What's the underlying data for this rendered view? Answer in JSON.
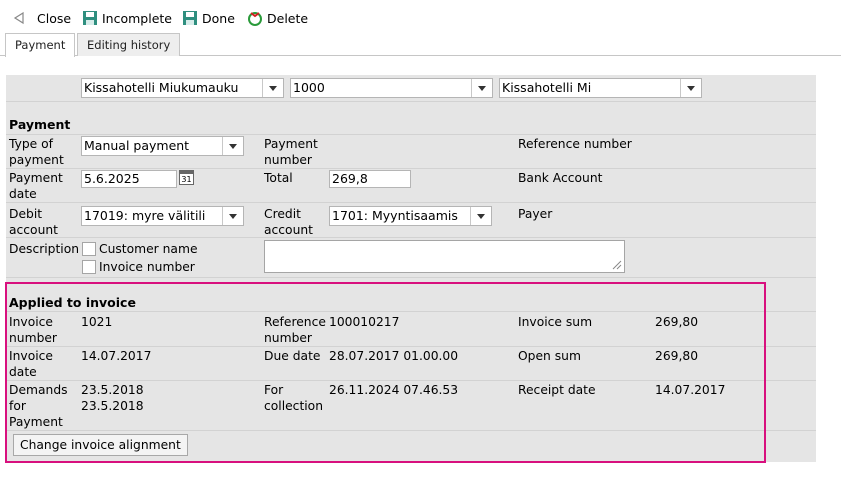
{
  "toolbar": {
    "close": "Close",
    "incomplete": "Incomplete",
    "done": "Done",
    "delete": "Delete"
  },
  "tabs": [
    "Payment",
    "Editing history"
  ],
  "top_selects": {
    "company": "Kissahotelli Miukumauku",
    "code": "1000",
    "short_name": "Kissahotelli Mi"
  },
  "payment": {
    "heading": "Payment",
    "type_label": "Type of payment",
    "type_value": "Manual payment",
    "number_label": "Payment number",
    "reference_label": "Reference number",
    "date_label": "Payment date",
    "date_value": "5.6.2025",
    "calendar_day": "31",
    "total_label": "Total",
    "total_value": "269,8",
    "bank_account_label": "Bank Account",
    "debit_label": "Debit account",
    "debit_value": "17019: myre välitili",
    "credit_label": "Credit account",
    "credit_value": "1701: Myyntisaamis",
    "payer_label": "Payer",
    "description_label": "Description",
    "customer_name_label": "Customer name",
    "invoice_number_label": "Invoice number"
  },
  "applied": {
    "heading": "Applied to invoice",
    "invoice_number_label": "Invoice number",
    "invoice_number": "1021",
    "reference_label": "Reference number",
    "reference": "100010217",
    "invoice_sum_label": "Invoice sum",
    "invoice_sum": "269,80",
    "invoice_date_label": "Invoice date",
    "invoice_date": "14.07.2017",
    "due_date_label": "Due date",
    "due_date": "28.07.2017 01.00.00",
    "open_sum_label": "Open sum",
    "open_sum": "269,80",
    "demands_label": "Demands for Payment",
    "demands_1": "23.5.2018",
    "demands_2": "23.5.2018",
    "collection_label": "For collection",
    "collection": "26.11.2024 07.46.53",
    "receipt_date_label": "Receipt date",
    "receipt_date": "14.07.2017",
    "change_button": "Change invoice alignment"
  },
  "colors": {
    "highlight": "#d8107e",
    "panel": "#e5e5e5",
    "save_icon": "#2f8f7f"
  }
}
